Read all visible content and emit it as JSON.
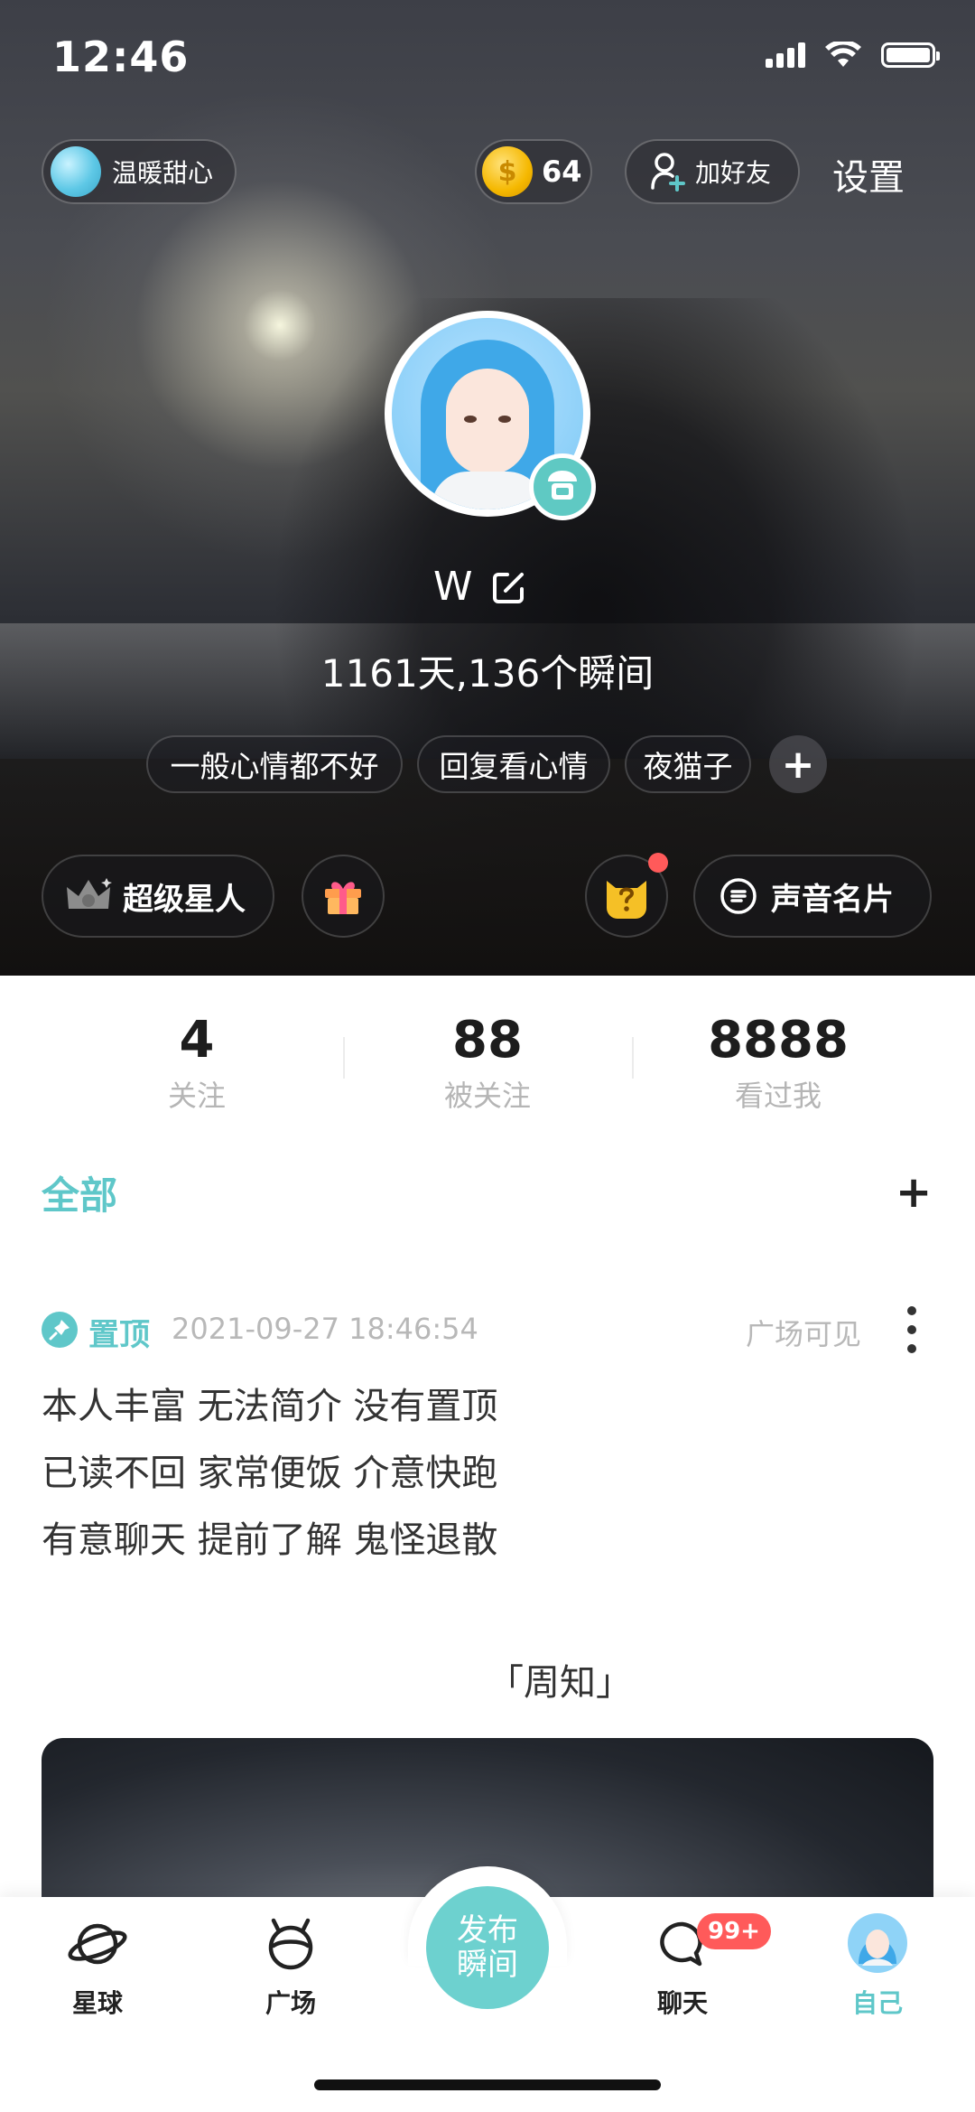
{
  "status_bar": {
    "time": "12:46"
  },
  "header": {
    "mood_label": "温暖甜心",
    "coin_count": "64",
    "coin_symbol": "$",
    "add_friend_label": "加好友",
    "settings_label": "设置"
  },
  "profile": {
    "username": "W",
    "summary": "1161天,136个瞬间",
    "tags": [
      "一般心情都不好",
      "回复看心情",
      "夜猫子"
    ],
    "tag_add": "+",
    "superstar_label": "超级星人",
    "voice_card_label": "声音名片"
  },
  "stats": [
    {
      "value": "4",
      "label": "关注"
    },
    {
      "value": "88",
      "label": "被关注"
    },
    {
      "value": "8888",
      "label": "看过我"
    }
  ],
  "filter": {
    "all_label": "全部",
    "add_label": "+"
  },
  "post": {
    "pin_label": "置顶",
    "timestamp": "2021-09-27 18:46:54",
    "visibility": "广场可见",
    "lines": [
      "本人丰富 无法简介 没有置顶",
      "已读不回 家常便饭 介意快跑",
      "有意聊天 提前了解 鬼怪退散"
    ],
    "caption": "「周知」"
  },
  "tab_bar": {
    "tabs": [
      {
        "label": "星球",
        "icon": "planet-icon"
      },
      {
        "label": "广场",
        "icon": "square-icon"
      },
      {
        "label": "聊天",
        "icon": "chat-icon"
      },
      {
        "label": "自己",
        "icon": "avatar-icon"
      }
    ],
    "publish_line1": "发布",
    "publish_line2": "瞬间",
    "chat_badge": "99+"
  },
  "colors": {
    "accent": "#5fc7c9",
    "badge_red": "#ff5a5a"
  }
}
